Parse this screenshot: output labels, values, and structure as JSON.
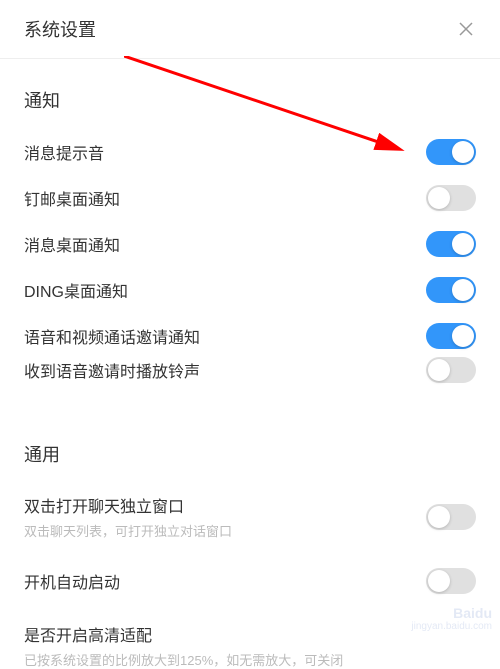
{
  "header": {
    "title": "系统设置"
  },
  "sections": {
    "notification": {
      "title": "通知",
      "items": [
        {
          "label": "消息提示音",
          "on": true
        },
        {
          "label": "钉邮桌面通知",
          "on": false
        },
        {
          "label": "消息桌面通知",
          "on": true
        },
        {
          "label": "DING桌面通知",
          "on": true
        },
        {
          "label": "语音和视频通话邀请通知",
          "on": true
        },
        {
          "label": "收到语音邀请时播放铃声",
          "on": false
        }
      ]
    },
    "general": {
      "title": "通用",
      "items": [
        {
          "label": "双击打开聊天独立窗口",
          "hint": "双击聊天列表，可打开独立对话窗口",
          "on": false
        },
        {
          "label": "开机自动启动",
          "on": false
        },
        {
          "label": "是否开启高清适配",
          "hint_cutoff": "已按系统设置的比例放大到125%，如无需放大，可关闭"
        }
      ]
    }
  },
  "annotation": {
    "type": "arrow",
    "color": "#ff0000"
  },
  "watermark": {
    "source": "Baidu",
    "url_fragment": "jingyan.baidu.com"
  }
}
